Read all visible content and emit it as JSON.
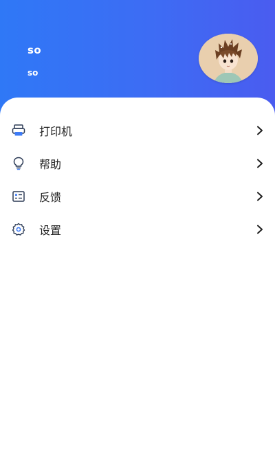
{
  "profile": {
    "name": "so",
    "subtitle": "so",
    "avatar_icon": "avatar-boy-illustration"
  },
  "colors": {
    "header_start": "#2f78f6",
    "header_end": "#4a5cf0",
    "icon": "#2b3a55",
    "text": "#222222"
  },
  "menu": {
    "items": [
      {
        "label": "打印机",
        "icon": "printer-icon"
      },
      {
        "label": "帮助",
        "icon": "lightbulb-icon"
      },
      {
        "label": "反馈",
        "icon": "feedback-icon"
      },
      {
        "label": "设置",
        "icon": "settings-icon"
      }
    ]
  }
}
